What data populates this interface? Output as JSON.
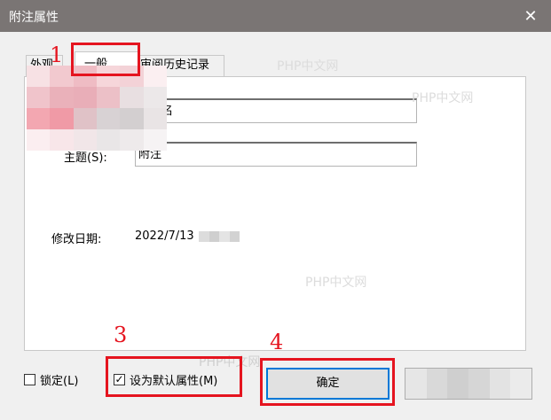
{
  "dialog": {
    "title": "附注属性",
    "close_glyph": "✕"
  },
  "tabs": [
    {
      "label": "外观",
      "active": false
    },
    {
      "label": "一般",
      "active": true
    },
    {
      "label": "审阅历史记录",
      "active": false
    }
  ],
  "fields": {
    "author": {
      "value": "的姓名"
    },
    "subject": {
      "label": "主题(S):",
      "value": "附注"
    },
    "modified": {
      "label": "修改日期:",
      "value": "2022/7/13"
    }
  },
  "footer": {
    "lock_label": "锁定(L)",
    "lock_checked": false,
    "default_label": "设为默认属性(M)",
    "default_checked": true,
    "ok_label": "确定"
  },
  "annotations": {
    "n1": "1",
    "n3": "3",
    "n4": "4"
  },
  "watermark": "PHP中文网",
  "colors": {
    "titlebar": "#7a7574",
    "annotation": "#e5141f",
    "primary_border": "#0078d7"
  }
}
